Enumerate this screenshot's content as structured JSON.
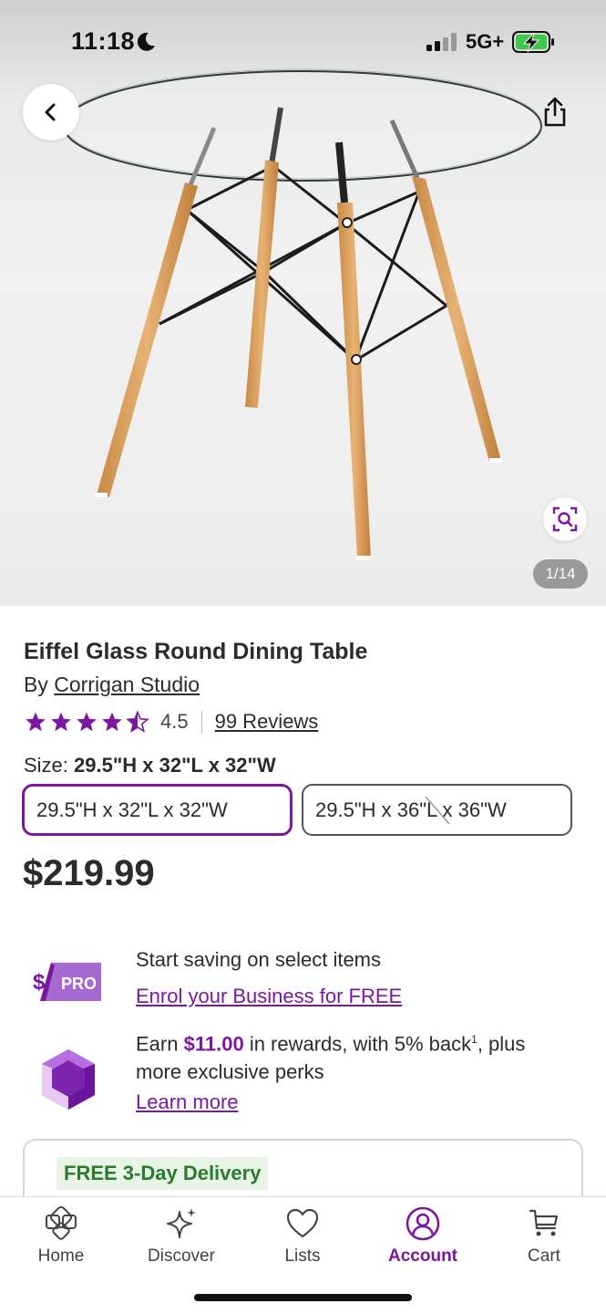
{
  "status_bar": {
    "time": "11:18",
    "network": "5G+"
  },
  "gallery": {
    "counter": "1/14"
  },
  "product": {
    "title": "Eiffel Glass Round Dining Table",
    "by_prefix": "By",
    "brand": "Corrigan Studio",
    "rating_value": "4.5",
    "rating_stars": 4.5,
    "reviews_label": "99 Reviews",
    "size_prefix": "Size:",
    "size_selected": "29.5\"H x 32\"L x 32\"W",
    "size_options": [
      "29.5\"H x 32\"L x 32\"W",
      "29.5\"H x 36\"L x 36\"W"
    ],
    "price": "$219.99"
  },
  "pro_promo": {
    "logo_text": "PRO",
    "logo_symbol": "$",
    "text": "Start saving on select items",
    "link": "Enrol your Business for FREE"
  },
  "rewards_promo": {
    "text_prefix": "Earn",
    "amount": "$11.00",
    "text_mid": "in rewards, with 5% back",
    "footnote": "1",
    "text_suffix": ", plus",
    "text_line2": "more exclusive perks",
    "link": "Learn more"
  },
  "delivery": {
    "badge": "FREE 3-Day Delivery"
  },
  "bottom_nav": {
    "items": [
      {
        "label": "Home",
        "icon": "home-icon"
      },
      {
        "label": "Discover",
        "icon": "sparkle-icon"
      },
      {
        "label": "Lists",
        "icon": "heart-icon"
      },
      {
        "label": "Account",
        "icon": "account-icon",
        "active": true
      },
      {
        "label": "Cart",
        "icon": "cart-icon"
      }
    ]
  },
  "colors": {
    "accent": "#7b189f",
    "delivery_green": "#2a7a2f",
    "delivery_bg": "#e8f4e6"
  }
}
